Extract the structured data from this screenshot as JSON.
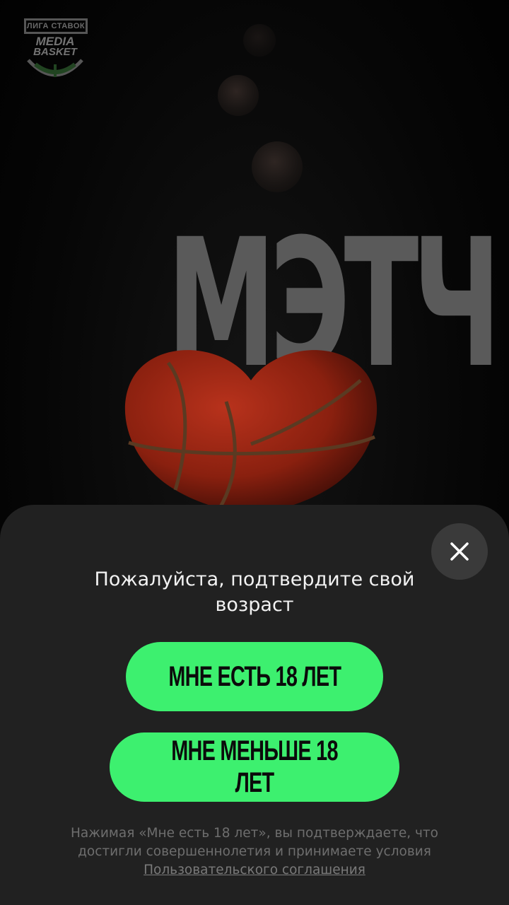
{
  "logo": {
    "top_text": "ЛИГА СТАВОК",
    "line1": "MEDIA",
    "line2": "BASKET"
  },
  "hero": {
    "word": "МЭТЧ"
  },
  "sheet": {
    "title": "Пожалуйста, подтвердите свой возраст",
    "btn_adult": "МНЕ ЕСТЬ 18 ЛЕТ",
    "btn_minor": "МНЕ МЕНЬШЕ 18 ЛЕТ",
    "disclaimer": "Нажимая «Мне есть 18 лет», вы подтверждаете, что достигли совершеннолетия и принимаете условия",
    "link": "Пользовательского соглашения",
    "close_icon": "close-icon"
  },
  "colors": {
    "accent": "#3df06f",
    "sheet_bg": "#212121",
    "close_bg": "#3a3a3a"
  }
}
